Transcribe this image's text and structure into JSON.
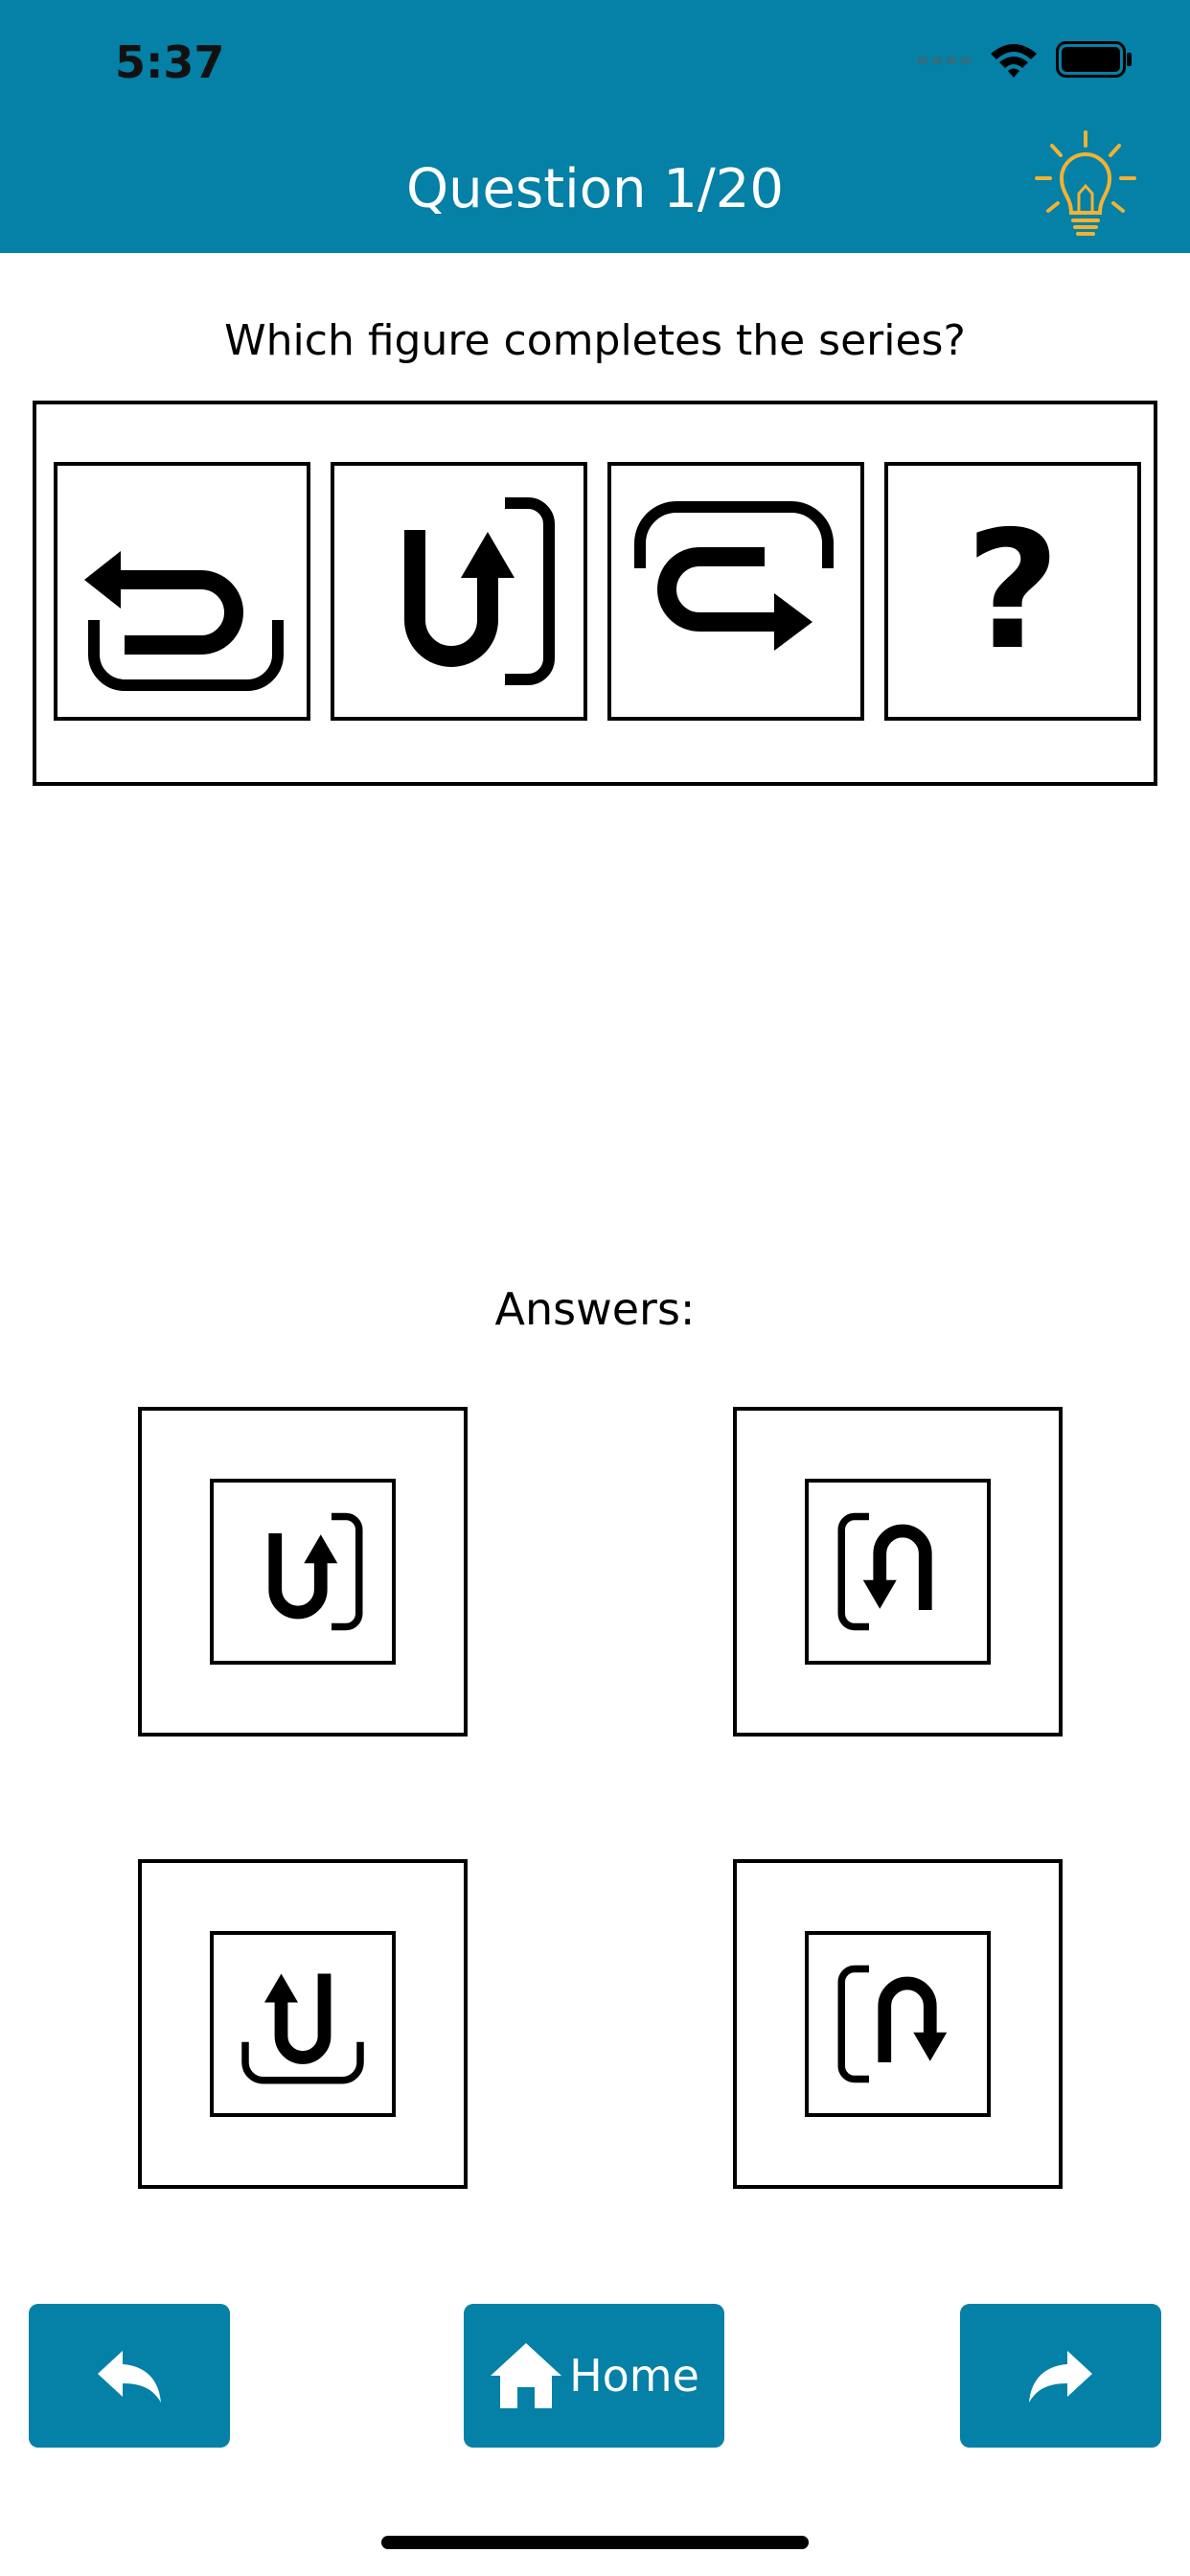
{
  "status_bar": {
    "time": "5:37"
  },
  "header": {
    "title": "Question 1/20",
    "hint_icon": "lightbulb-icon",
    "hint_color": "#f2b233",
    "background": "#0580a6"
  },
  "question": {
    "prompt": "Which figure completes the series?",
    "series": [
      {
        "icon": "return-arrow-tray-icon"
      },
      {
        "icon": "u-turn-up-right-bracket-icon"
      },
      {
        "icon": "loop-arrow-right-icon"
      },
      {
        "icon": "question-mark-icon",
        "text": "?"
      }
    ]
  },
  "answers": {
    "label": "Answers:",
    "options": [
      {
        "icon": "u-turn-up-right-bracket-icon"
      },
      {
        "icon": "n-turn-down-left-bracket-icon"
      },
      {
        "icon": "u-turn-up-tray-icon"
      },
      {
        "icon": "n-turn-down-right-left-bracket-icon"
      }
    ]
  },
  "nav": {
    "home_label": "Home",
    "back_icon": "reply-arrow-icon",
    "forward_icon": "forward-arrow-icon",
    "home_icon": "home-icon"
  }
}
